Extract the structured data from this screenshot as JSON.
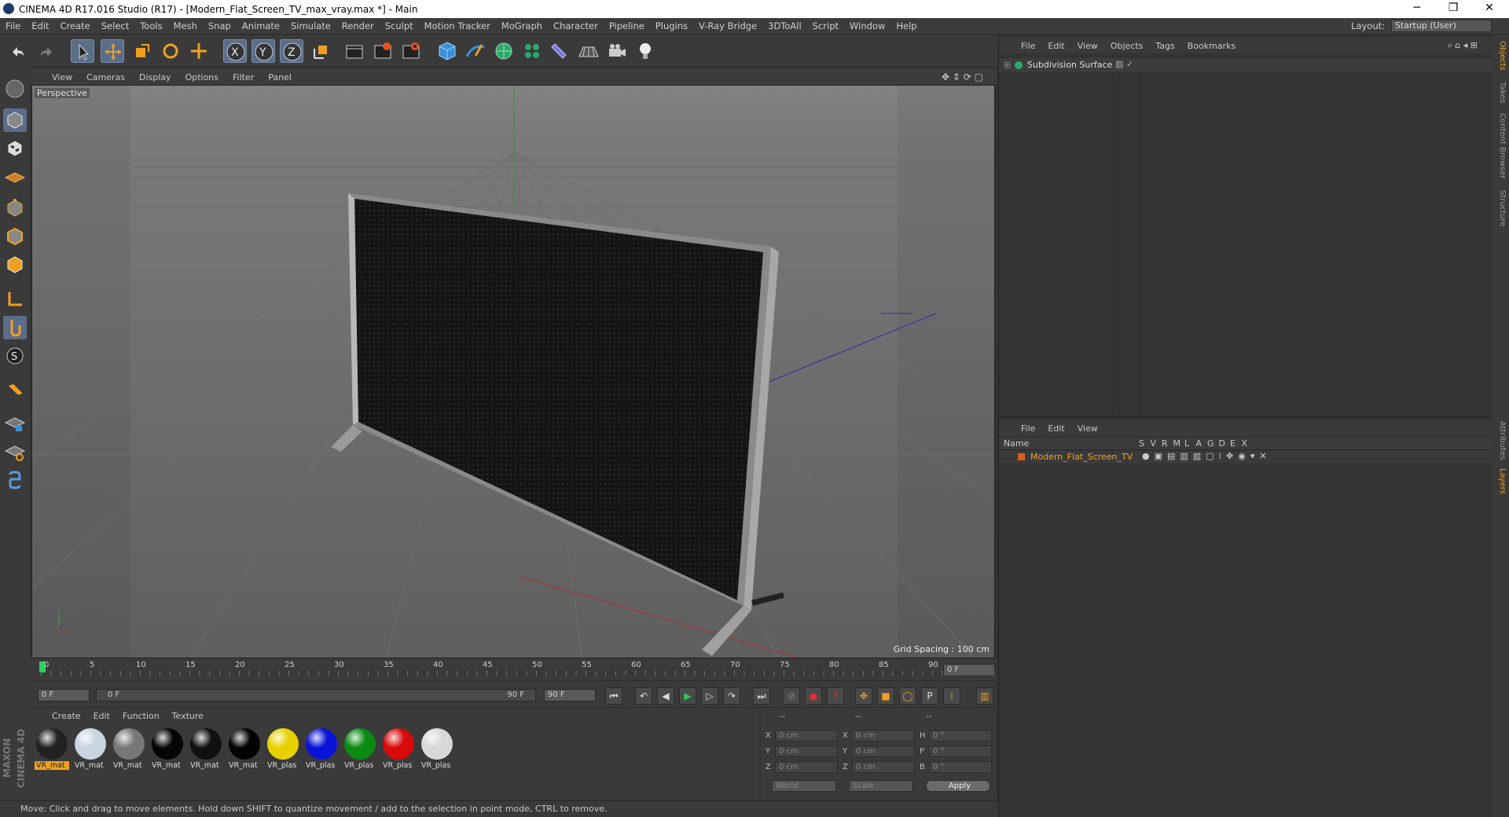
{
  "window": {
    "title": "CINEMA 4D R17.016 Studio (R17) - [Modern_Flat_Screen_TV_max_vray.max *] - Main",
    "minimize": "─",
    "maximize": "❐",
    "close": "✕"
  },
  "menubar": {
    "items": [
      "File",
      "Edit",
      "Create",
      "Select",
      "Tools",
      "Mesh",
      "Snap",
      "Animate",
      "Simulate",
      "Render",
      "Sculpt",
      "Motion Tracker",
      "MoGraph",
      "Character",
      "Pipeline",
      "Plugins",
      "V-Ray Bridge",
      "3DToAll",
      "Script",
      "Window",
      "Help"
    ],
    "layout_label": "Layout:",
    "layout_value": "Startup (User)"
  },
  "viewport": {
    "menu": [
      "View",
      "Cameras",
      "Display",
      "Options",
      "Filter",
      "Panel"
    ],
    "label": "Perspective",
    "grid_spacing": "Grid Spacing : 100 cm"
  },
  "timeline": {
    "ticks": [
      "0",
      "5",
      "10",
      "15",
      "20",
      "25",
      "30",
      "35",
      "40",
      "45",
      "50",
      "55",
      "60",
      "65",
      "70",
      "75",
      "80",
      "85",
      "90"
    ],
    "current": "0 F",
    "start": "0 F",
    "range_start": "0 F",
    "range_end": "90 F",
    "end": "90 F"
  },
  "materials": {
    "menu": [
      "Create",
      "Edit",
      "Function",
      "Texture"
    ],
    "items": [
      {
        "label": "VR_mat",
        "color": "#222"
      },
      {
        "label": "VR_mat",
        "color": "#c8d4e0"
      },
      {
        "label": "VR_mat",
        "color": "#777"
      },
      {
        "label": "VR_mat",
        "color": "#050505"
      },
      {
        "label": "VR_mat",
        "color": "#111"
      },
      {
        "label": "VR_mat",
        "color": "#030303"
      },
      {
        "label": "VR_plas",
        "color": "#e8d000"
      },
      {
        "label": "VR_plas",
        "color": "#0a14d8"
      },
      {
        "label": "VR_plas",
        "color": "#0b8a12"
      },
      {
        "label": "VR_plas",
        "color": "#d80a0a"
      },
      {
        "label": "VR_plas",
        "color": "#d8d8d8"
      }
    ]
  },
  "coords": {
    "header": [
      "--",
      "--",
      "--"
    ],
    "rows": [
      {
        "a": "X",
        "av": "0 cm",
        "b": "X",
        "bv": "0 cm",
        "c": "H",
        "cv": "0 °"
      },
      {
        "a": "Y",
        "av": "0 cm",
        "b": "Y",
        "bv": "0 cm",
        "c": "P",
        "cv": "0 °"
      },
      {
        "a": "Z",
        "av": "0 cm",
        "b": "Z",
        "bv": "0 cm",
        "c": "B",
        "cv": "0 °"
      }
    ],
    "mode1": "World",
    "mode2": "Scale",
    "apply": "Apply"
  },
  "objects": {
    "menu": [
      "File",
      "Edit",
      "View",
      "Objects",
      "Tags",
      "Bookmarks"
    ],
    "item": "Subdivision Surface"
  },
  "layers": {
    "menu": [
      "File",
      "Edit",
      "View"
    ],
    "name_header": "Name",
    "cols": [
      "S",
      "V",
      "R",
      "M",
      "L",
      "A",
      "G",
      "D",
      "E",
      "X"
    ],
    "item": "Modern_Flat_Screen_TV"
  },
  "sidetabs": [
    "Objects",
    "Takes",
    "Content Browser",
    "Structure",
    "Attributes",
    "Layers"
  ],
  "status": "Move: Click and drag to move elements. Hold down SHIFT to quantize movement / add to the selection in point mode, CTRL to remove.",
  "brand": "MAXON CINEMA 4D",
  "icons": [
    "undo-icon",
    "redo-icon",
    "select-icon",
    "move-icon",
    "scale-icon",
    "rotate-icon",
    "x-axis-icon",
    "y-axis-icon",
    "z-axis-icon",
    "coord-system-icon",
    "render-view-icon",
    "render-picture-viewer-icon",
    "edit-render-settings-icon",
    "cube-icon",
    "pen-icon",
    "subdivision-icon",
    "mograph-cloner-icon",
    "deformer-icon",
    "scene-floor-icon",
    "camera-icon",
    "light-icon"
  ]
}
